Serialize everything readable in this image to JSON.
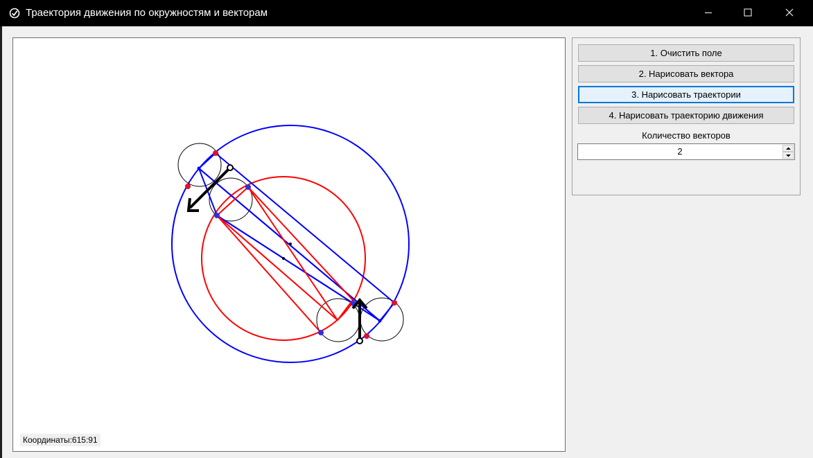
{
  "window": {
    "title": "Траектория движения по окружностям и векторам",
    "controls": [
      "minimize-icon",
      "maximize-icon",
      "close-icon"
    ]
  },
  "buttons": {
    "clear": "1. Очистить поле",
    "draw_vectors": "2. Нарисовать вектора",
    "draw_trajectories": "3. Нарисовать траектории",
    "draw_motion": "4. Нарисовать траекторию движения"
  },
  "vectors_count": {
    "label": "Количество векторов",
    "value": "2"
  },
  "status": {
    "coordinates": "Координаты:615:91"
  },
  "colors": {
    "accent": "#0078d7",
    "blue_trajectory": "#0000ff",
    "red_trajectory": "#ff0000",
    "vector": "#000000"
  }
}
